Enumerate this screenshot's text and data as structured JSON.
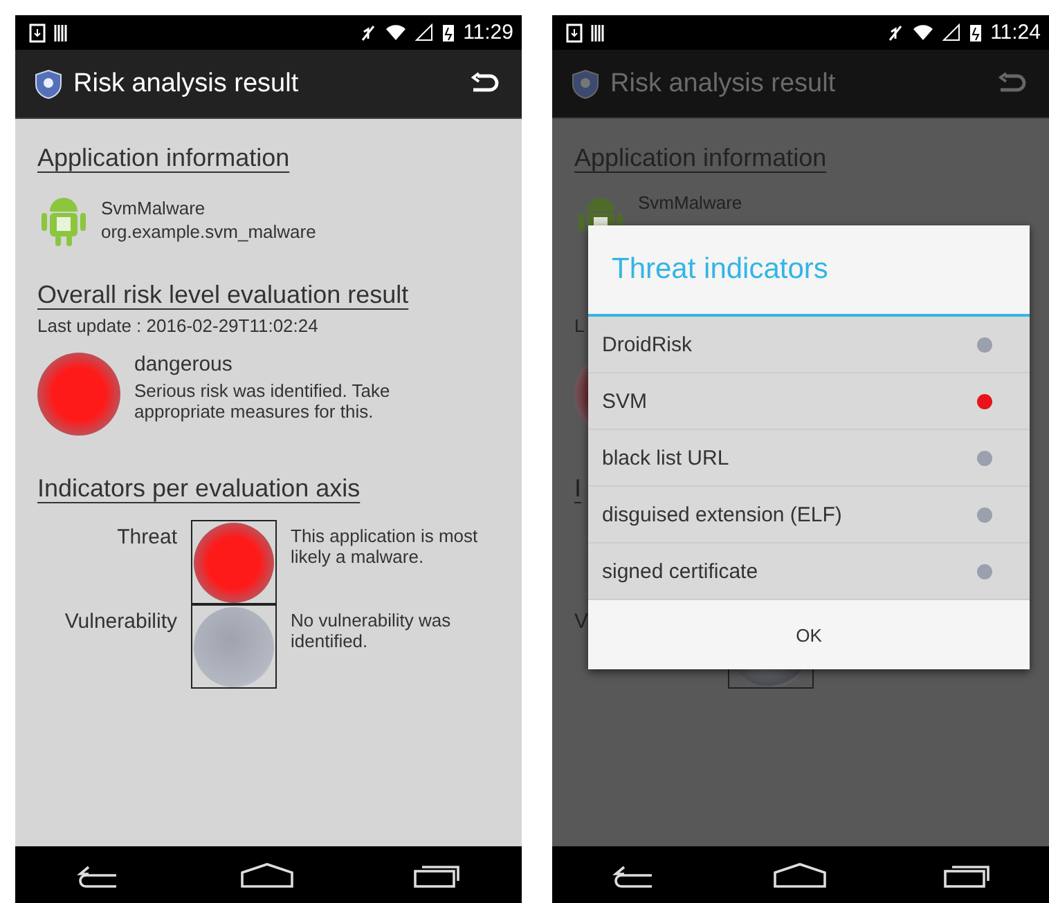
{
  "left_screen": {
    "status_time": "11:29",
    "title": "Risk analysis result",
    "app_info": {
      "heading": "Application information",
      "name": "SvmMalware",
      "package": "org.example.svm_malware"
    },
    "overall": {
      "heading": "Overall risk level evaluation result",
      "last_update": "Last update : 2016-02-29T11:02:24",
      "level": "dangerous",
      "description": "Serious risk was identified. Take appropriate measures for this."
    },
    "axes": {
      "heading": "Indicators per evaluation axis",
      "items": [
        {
          "label": "Threat",
          "color": "#ff1a1a",
          "description": "This application is most likely a malware."
        },
        {
          "label": "Vulnerability",
          "color": "#b4b8c2",
          "description": "No vulnerability was identified."
        }
      ]
    }
  },
  "right_screen": {
    "status_time": "11:24",
    "title": "Risk analysis result",
    "background": {
      "heading": "Application information",
      "app_name": "SvmMalware",
      "last_update_fragment": "L",
      "axes_heading_fragment": "I",
      "axis_label_fragment": "V"
    },
    "dialog": {
      "title": "Threat indicators",
      "items": [
        {
          "label": "DroidRisk",
          "color": "#9aa0ae"
        },
        {
          "label": "SVM",
          "color": "#e8141a"
        },
        {
          "label": "black list URL",
          "color": "#9aa0ae"
        },
        {
          "label": "disguised extension (ELF)",
          "color": "#9aa0ae"
        },
        {
          "label": "signed certificate",
          "color": "#9aa0ae"
        }
      ],
      "button": "OK"
    }
  }
}
